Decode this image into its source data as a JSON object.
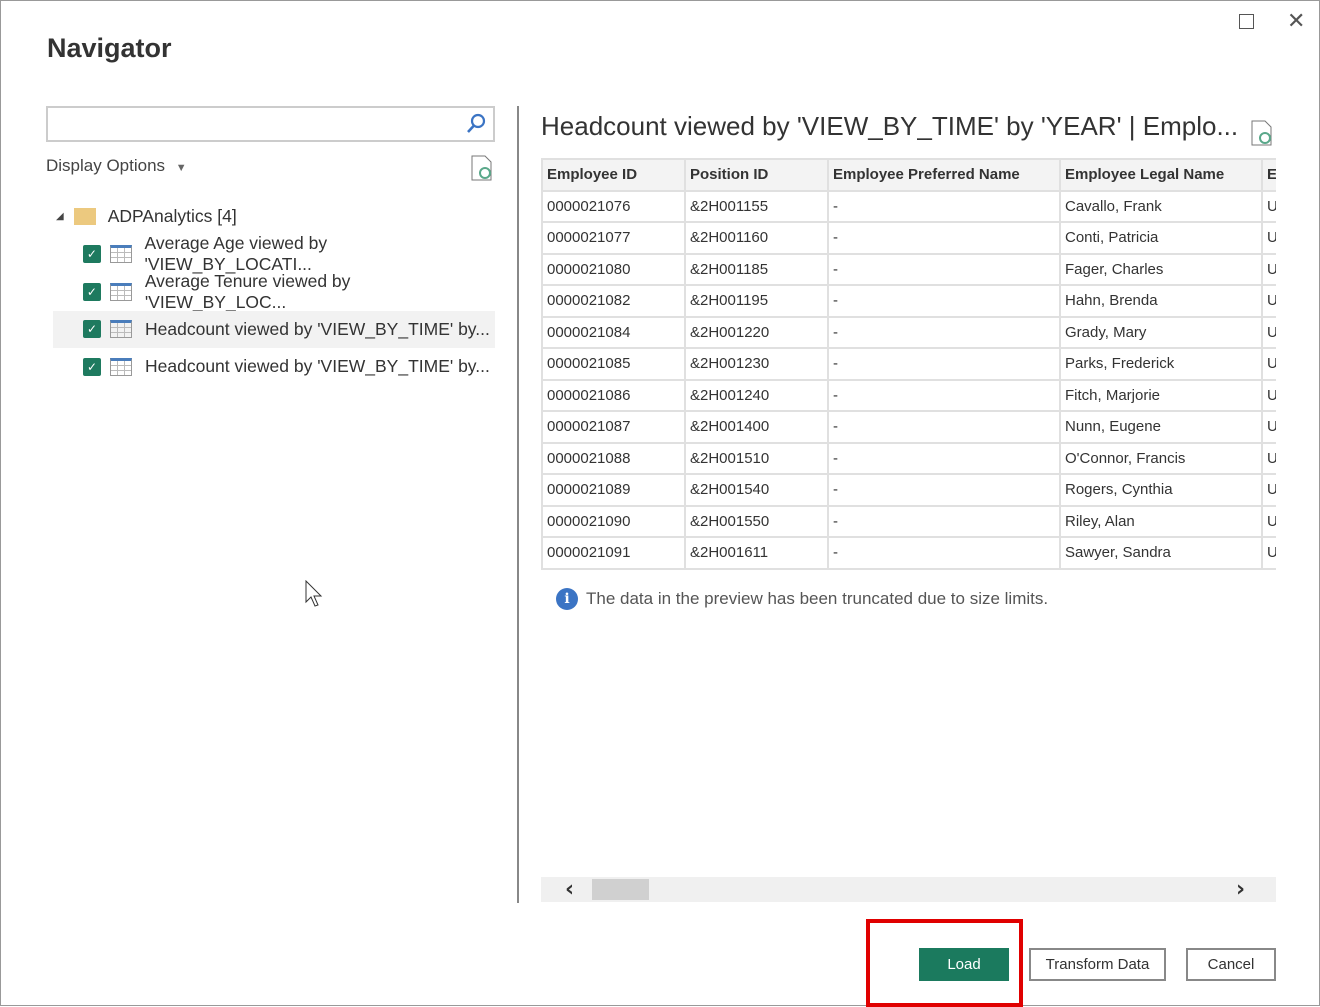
{
  "window": {
    "title": "Navigator"
  },
  "search": {
    "placeholder": "",
    "value": ""
  },
  "display_options": "Display Options",
  "tree": {
    "root": "ADPAnalytics [4]",
    "items": [
      {
        "label": "Average Age viewed by 'VIEW_BY_LOCATI...",
        "checked": true
      },
      {
        "label": "Average Tenure viewed by 'VIEW_BY_LOC...",
        "checked": true
      },
      {
        "label": "Headcount viewed by 'VIEW_BY_TIME' by...",
        "checked": true,
        "selected": true
      },
      {
        "label": "Headcount viewed by 'VIEW_BY_TIME' by...",
        "checked": true
      }
    ]
  },
  "preview": {
    "title": "Headcount viewed by 'VIEW_BY_TIME' by 'YEAR' | Emplo...",
    "columns": [
      "Employee ID",
      "Position ID",
      "Employee Preferred Name",
      "Employee Legal Name",
      "El"
    ],
    "rows": [
      [
        "0000021076",
        "&2H001155",
        "-",
        "Cavallo, Frank",
        "U"
      ],
      [
        "0000021077",
        "&2H001160",
        "-",
        "Conti, Patricia",
        "U"
      ],
      [
        "0000021080",
        "&2H001185",
        "-",
        "Fager, Charles",
        "U"
      ],
      [
        "0000021082",
        "&2H001195",
        "-",
        "Hahn, Brenda",
        "U"
      ],
      [
        "0000021084",
        "&2H001220",
        "-",
        "Grady, Mary",
        "U"
      ],
      [
        "0000021085",
        "&2H001230",
        "-",
        "Parks, Frederick",
        "U"
      ],
      [
        "0000021086",
        "&2H001240",
        "-",
        "Fitch, Marjorie",
        "U"
      ],
      [
        "0000021087",
        "&2H001400",
        "-",
        "Nunn, Eugene",
        "U"
      ],
      [
        "0000021088",
        "&2H001510",
        "-",
        "O'Connor, Francis",
        "U"
      ],
      [
        "0000021089",
        "&2H001540",
        "-",
        "Rogers, Cynthia",
        "U"
      ],
      [
        "0000021090",
        "&2H001550",
        "-",
        "Riley, Alan",
        "U"
      ],
      [
        "0000021091",
        "&2H001611",
        "-",
        "Sawyer, Sandra",
        "U"
      ]
    ],
    "note": "The data in the preview has been truncated due to size limits."
  },
  "buttons": {
    "load": "Load",
    "transform": "Transform Data",
    "cancel": "Cancel"
  },
  "colors": {
    "accent": "#1b7a5e",
    "highlight": "#e00000"
  }
}
